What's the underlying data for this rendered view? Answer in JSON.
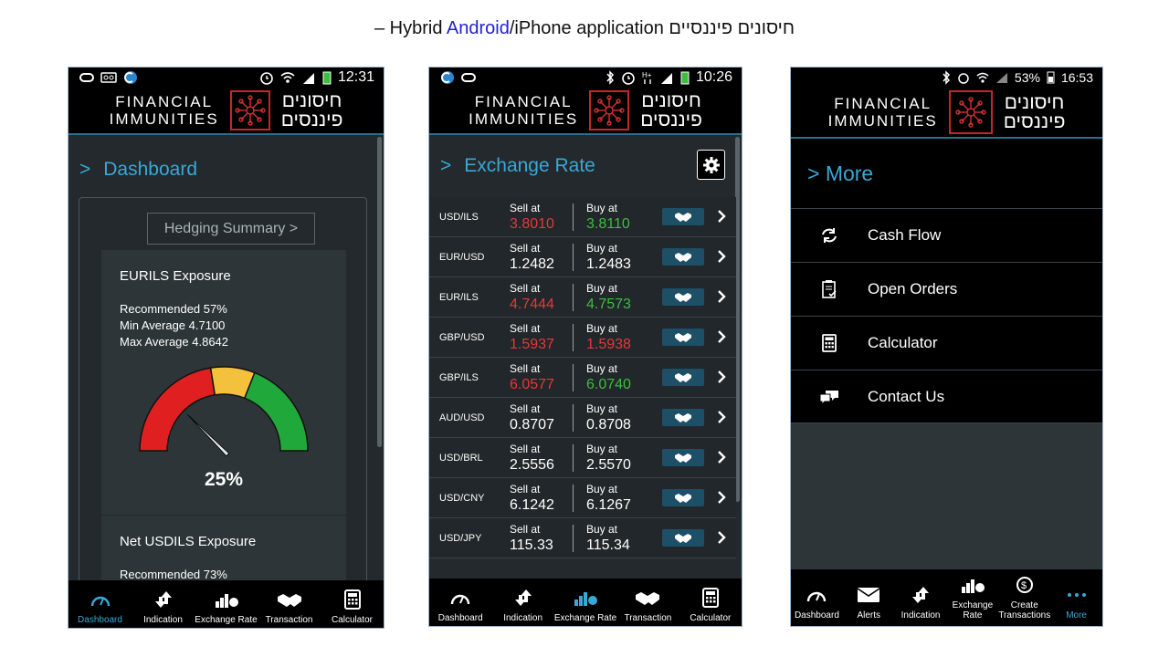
{
  "slide": {
    "title_prefix": "– Hybrid ",
    "title_android": "Android",
    "title_suffix": "/iPhone application חיסונים פיננסיים"
  },
  "brand": {
    "logo_en_line1": "FINANCIAL",
    "logo_en_line2": "IMMUNITIES",
    "logo_he_line1": "חיסונים",
    "logo_he_line2": "פיננסים"
  },
  "colors": {
    "accent": "#39a8d6",
    "sell": "#e23a3a",
    "buy": "#3cbf3c",
    "gauge_red": "#e02020",
    "gauge_yellow": "#f4c13c",
    "gauge_green": "#21a83a"
  },
  "phone1": {
    "status_time": "12:31",
    "section_arrow": ">",
    "section_title": "Dashboard",
    "hedging_button": "Hedging Summary >",
    "exposure1": {
      "title": "EURILS Exposure",
      "recommended": "Recommended 57%",
      "min_average": "Min Average 4.7100",
      "max_average": "Max Average 4.8642",
      "gauge_percent": "25%",
      "gauge_value": 0.25
    },
    "exposure2": {
      "title": "Net USDILS Exposure",
      "recommended": "Recommended 73%"
    },
    "tabs": [
      "Dashboard",
      "Indication",
      "Exchange Rate",
      "Transaction",
      "Calculator"
    ]
  },
  "phone2": {
    "status_time": "10:26",
    "section_arrow": ">",
    "section_title": "Exchange Rate",
    "sell_label": "Sell at",
    "buy_label": "Buy at",
    "rates": [
      {
        "pair": "USD/ILS",
        "sell": "3.8010",
        "buy": "3.8110",
        "sell_color": "red",
        "buy_color": "green"
      },
      {
        "pair": "EUR/USD",
        "sell": "1.2482",
        "buy": "1.2483",
        "sell_color": "white",
        "buy_color": "white"
      },
      {
        "pair": "EUR/ILS",
        "sell": "4.7444",
        "buy": "4.7573",
        "sell_color": "red",
        "buy_color": "green"
      },
      {
        "pair": "GBP/USD",
        "sell": "1.5937",
        "buy": "1.5938",
        "sell_color": "red",
        "buy_color": "red"
      },
      {
        "pair": "GBP/ILS",
        "sell": "6.0577",
        "buy": "6.0740",
        "sell_color": "red",
        "buy_color": "green"
      },
      {
        "pair": "AUD/USD",
        "sell": "0.8707",
        "buy": "0.8708",
        "sell_color": "white",
        "buy_color": "white"
      },
      {
        "pair": "USD/BRL",
        "sell": "2.5556",
        "buy": "2.5570",
        "sell_color": "white",
        "buy_color": "white"
      },
      {
        "pair": "USD/CNY",
        "sell": "6.1242",
        "buy": "6.1267",
        "sell_color": "white",
        "buy_color": "white"
      },
      {
        "pair": "USD/JPY",
        "sell": "115.33",
        "buy": "115.34",
        "sell_color": "white",
        "buy_color": "white"
      }
    ],
    "tabs": [
      "Dashboard",
      "Indication",
      "Exchange Rate",
      "Transaction",
      "Calculator"
    ]
  },
  "phone3": {
    "status_battery": "53%",
    "status_time": "16:53",
    "section_title": "> More",
    "menu": [
      {
        "label": "Cash Flow",
        "icon": "cash-flow-icon"
      },
      {
        "label": "Open Orders",
        "icon": "open-orders-icon"
      },
      {
        "label": "Calculator",
        "icon": "calculator-icon"
      },
      {
        "label": "Contact Us",
        "icon": "contact-us-icon"
      }
    ],
    "tabs": [
      "Dashboard",
      "Alerts",
      "Indication",
      "Exchange",
      "Rate",
      "Create",
      "Transactions",
      "More"
    ]
  }
}
